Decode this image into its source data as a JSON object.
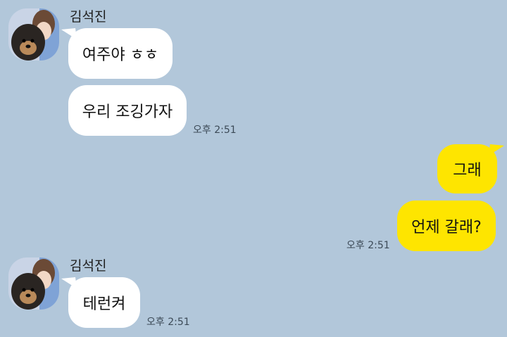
{
  "theme": {
    "background": "#b2c7da",
    "incoming_bubble": "#ffffff",
    "outgoing_bubble": "#fee500"
  },
  "messages": {
    "group1": {
      "sender": "김석진",
      "avatar_icon": "profile-photo-with-dog",
      "bubble1": "여주야 ㅎㅎ",
      "bubble2": "우리 조깅가자",
      "time": "오후 2:51"
    },
    "group2": {
      "bubble1": "그래",
      "bubble2": "언제 갈래?",
      "time": "오후 2:51"
    },
    "group3": {
      "sender": "김석진",
      "avatar_icon": "profile-photo-with-dog",
      "bubble1": "테런켜",
      "time": "오후 2:51"
    }
  }
}
